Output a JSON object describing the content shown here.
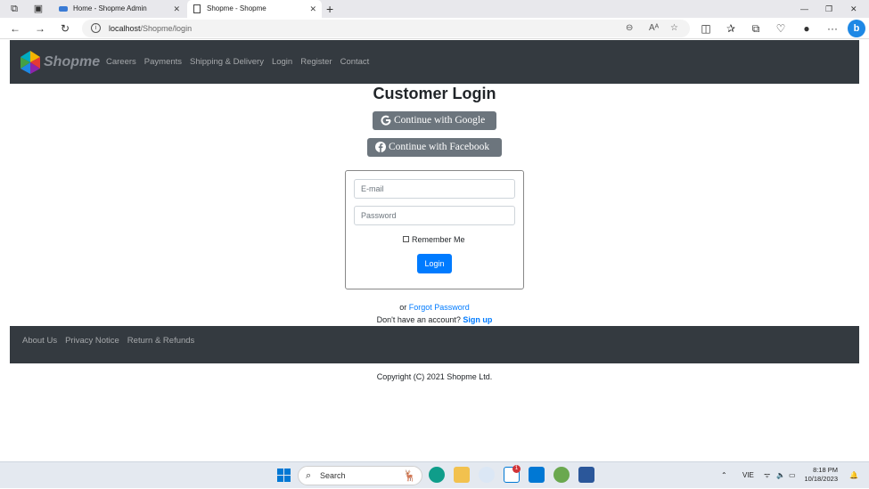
{
  "browser": {
    "tabs": [
      {
        "title": "Home - Shopme Admin",
        "active": false
      },
      {
        "title": "Shopme - Shopme",
        "active": true
      }
    ],
    "url_host": "localhost",
    "url_path": "/Shopme/login"
  },
  "site": {
    "logo_text": "Shopme",
    "nav": [
      "Careers",
      "Payments",
      "Shipping & Delivery",
      "Login",
      "Register",
      "Contact"
    ]
  },
  "login": {
    "title": "Customer Login",
    "google_label": "Continue with Google",
    "facebook_label": "Continue with Facebook",
    "email_placeholder": "E-mail",
    "password_placeholder": "Password",
    "remember_label": "Remember Me",
    "login_button": "Login",
    "or_text": "or",
    "forgot_label": "Forgot Password",
    "no_account_text": "Don't have an account?",
    "signup_label": "Sign up"
  },
  "footer": {
    "links": [
      "About Us",
      "Privacy Notice",
      "Return & Refunds"
    ],
    "copyright": "Copyright (C) 2021 Shopme Ltd."
  },
  "taskbar": {
    "search_label": "Search",
    "lang": "VIE",
    "time": "8:18 PM",
    "date": "10/18/2023",
    "notification_count": "1"
  },
  "colors": {
    "navbar_bg": "#343a40",
    "primary": "#007bff",
    "social_btn": "#6c757d"
  }
}
